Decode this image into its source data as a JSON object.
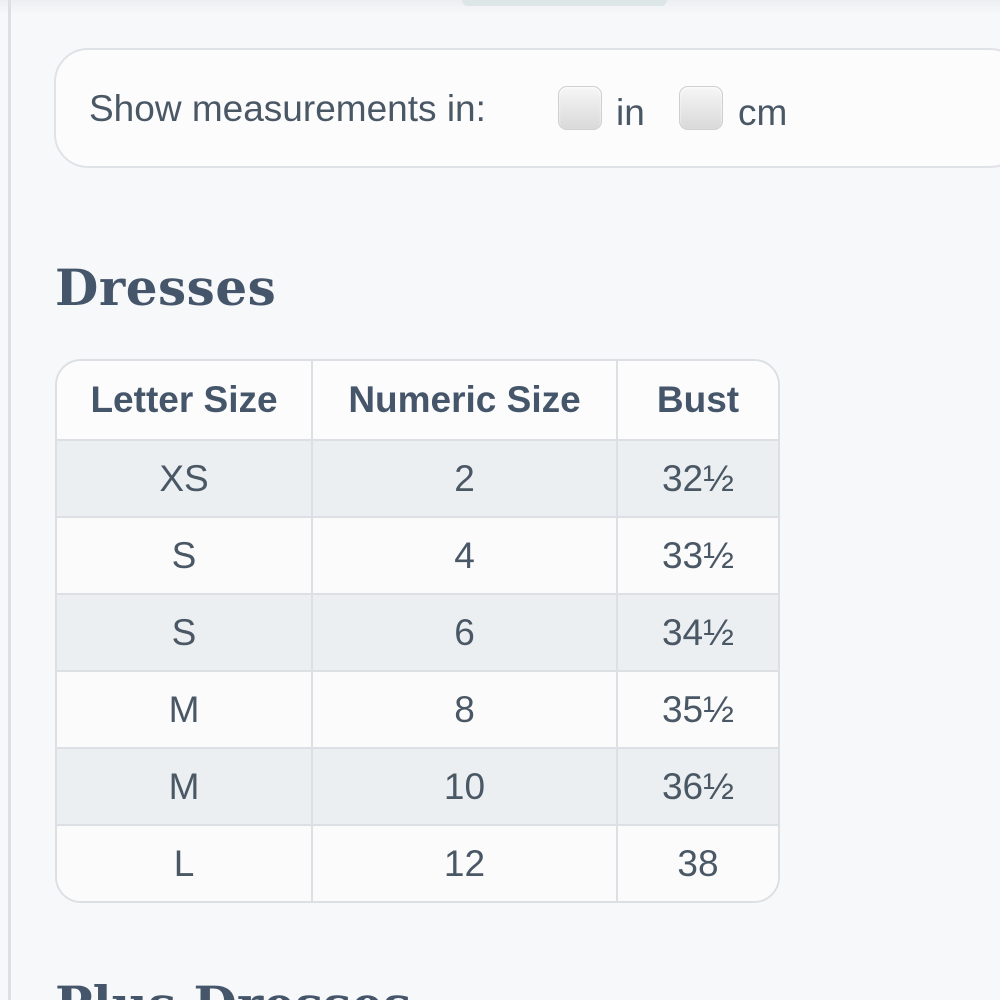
{
  "units": {
    "label": "Show measurements in:",
    "options": [
      {
        "label": "in",
        "checked": false
      },
      {
        "label": "cm",
        "checked": false
      }
    ]
  },
  "dresses": {
    "title": "Dresses",
    "columns": [
      "Letter Size",
      "Numeric Size",
      "Bust"
    ],
    "rows": [
      [
        "XS",
        "2",
        "32½"
      ],
      [
        "S",
        "4",
        "33½"
      ],
      [
        "S",
        "6",
        "34½"
      ],
      [
        "M",
        "8",
        "35½"
      ],
      [
        "M",
        "10",
        "36½"
      ],
      [
        "L",
        "12",
        "38"
      ]
    ]
  },
  "next_section": {
    "title": "Plus Dresses"
  },
  "colors": {
    "text": "#4a5765",
    "heading": "#46566a",
    "border": "#dcdfe3",
    "stripe": "#eceff1",
    "background": "#f7f8fa"
  }
}
